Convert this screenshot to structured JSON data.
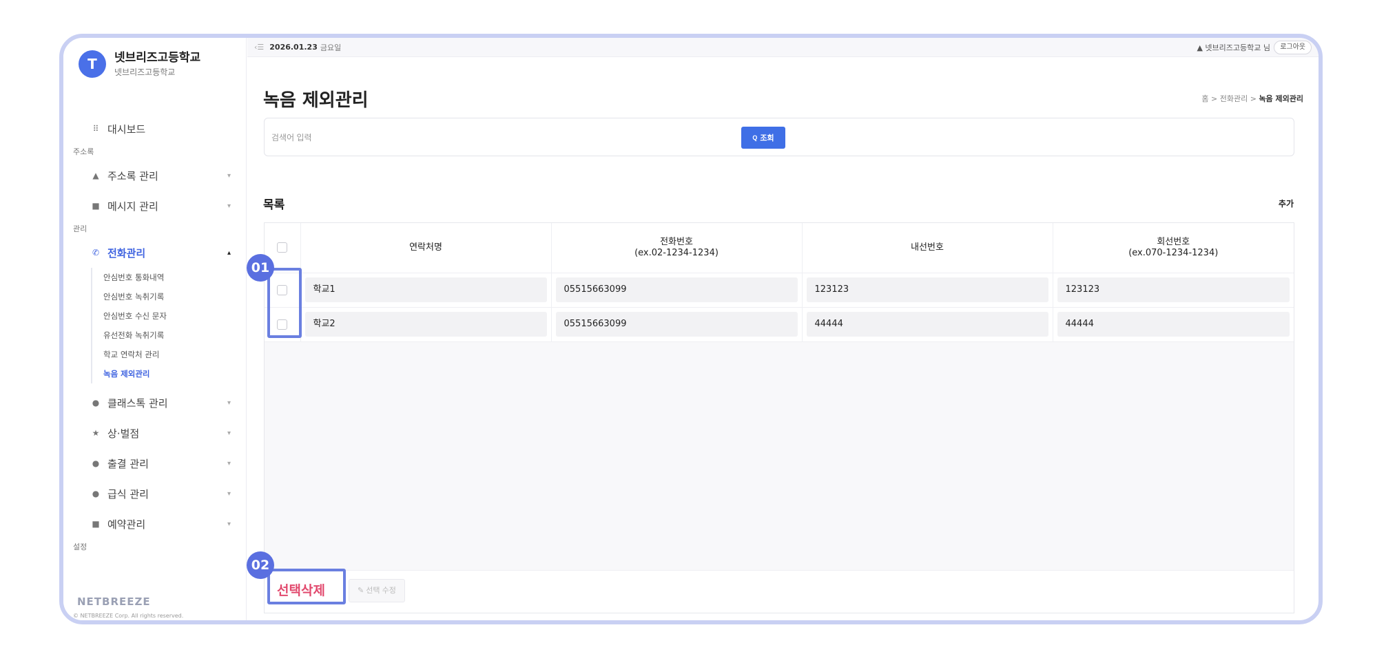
{
  "sidebar": {
    "avatar_letter": "T",
    "school_name": "넷브리즈고등학교",
    "school_sub": "넷브리즈고등학교",
    "dashboard": "대시보드",
    "section_address": "주소록",
    "address_mgmt": "주소록 관리",
    "message_mgmt": "메시지 관리",
    "section_manage": "관리",
    "call_mgmt": "전화관리",
    "call_sub": [
      "안심번호 통화내역",
      "안심번호 녹취기록",
      "안심번호 수신 문자",
      "유선전화 녹취기록",
      "학교 연락처 관리",
      "녹음 제외관리"
    ],
    "classtalk_mgmt": "클래스톡 관리",
    "reward_penalty": "상·벌점",
    "attendance_mgmt": "출결 관리",
    "meal_mgmt": "급식 관리",
    "reservation_mgmt": "예약관리",
    "section_settings": "설정",
    "logo": "NETBREEZE",
    "copyright": "© NETBREEZE Corp. All rights reserved."
  },
  "topbar": {
    "collapse_icon": "‹☰",
    "date": "2026.01.23",
    "day": "금요일",
    "user": "넷브리즈고등학교 님",
    "logout": "로그아웃"
  },
  "page": {
    "title": "녹음 제외관리",
    "breadcrumb_home": "홈",
    "breadcrumb_sep": ">",
    "breadcrumb_mid": "전화관리",
    "breadcrumb_current": "녹음 제외관리"
  },
  "search": {
    "placeholder": "검색어 입력",
    "button": "조회",
    "button_icon": "Q"
  },
  "list": {
    "title": "목록",
    "add": "추가",
    "headers": [
      "연락처명",
      "전화번호\n(ex.02-1234-1234)",
      "내선번호",
      "회선번호\n(ex.070-1234-1234)"
    ],
    "rows": [
      [
        "학교1",
        "05515663099",
        "123123",
        "123123"
      ],
      [
        "학교2",
        "05515663099",
        "44444",
        "44444"
      ]
    ],
    "delete_selected": "선택삭제",
    "edit_selected": "선택 수정"
  },
  "annotations": {
    "badge1": "01",
    "badge2": "02"
  },
  "colors": {
    "accent": "#3f6fe6",
    "annotation": "#5a6fe0",
    "delete": "#e24a6e",
    "frame": "#c9d0f3"
  }
}
